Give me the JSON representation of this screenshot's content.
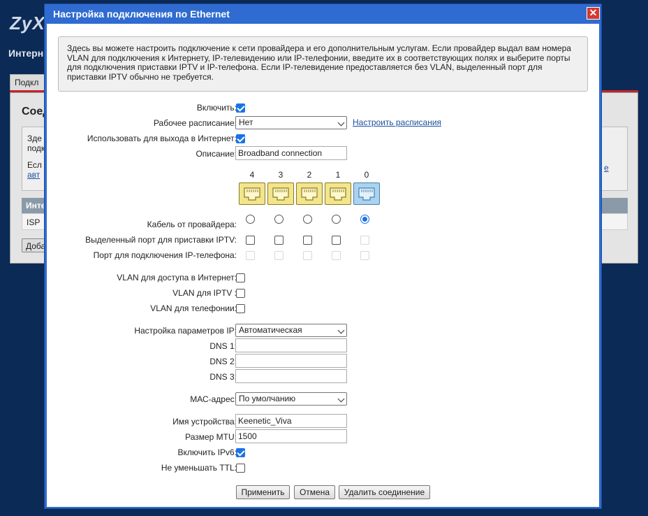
{
  "background": {
    "logo": "ZyX",
    "heading": "Интерн",
    "tab": "Подкл",
    "panel_title": "Соед",
    "text_line_1": "Зде",
    "text_line_2": "подк",
    "text_line_3": "Есл",
    "text_line_4": "авт",
    "link_fragment": "е",
    "table_header": "Инте",
    "table_row": "ISP",
    "add_button": "Доба"
  },
  "dialog": {
    "title": "Настройка подключения по Ethernet",
    "close": "✕",
    "intro": "Здесь вы можете настроить подключение к сети провайдера и его дополнительным услугам. Если провайдер выдал вам номера VLAN для подключения к Интернету, IP-телевидению или IP-телефонии, введите их в соответствующих полях и выберите порты для подключения приставки IPTV и IP-телефона. Если IP-телевидение предоставляется без VLAN, выделенный порт для приставки IPTV обычно не требуется.",
    "labels": {
      "enable": "Включить:",
      "schedule": "Рабочее расписание:",
      "use_internet": "Использовать для выхода в Интернет:",
      "description": "Описание:",
      "provider_cable": "Кабель от провайдера:",
      "iptv_port": "Выделенный порт для приставки IPTV:",
      "phone_port": "Порт для подключения IP-телефона:",
      "vlan_internet": "VLAN для доступа в Интернет:",
      "vlan_iptv": "VLAN для IPTV :",
      "vlan_phone": "VLAN для телефонии:",
      "ip_settings": "Настройка параметров IP:",
      "dns1": "DNS 1:",
      "dns2": "DNS 2:",
      "dns3": "DNS 3:",
      "mac": "МАС-адрес:",
      "device_name": "Имя устройства:",
      "mtu": "Размер MTU:",
      "ipv6": "Включить IPv6:",
      "ttl": "Не уменьшать TTL:"
    },
    "values": {
      "enable": true,
      "schedule": "Нет",
      "schedule_link": "Настроить расписания",
      "use_internet": true,
      "description": "Broadband connection",
      "ports": [
        "4",
        "3",
        "2",
        "1",
        "0"
      ],
      "provider_cable_selected": "0",
      "vlan_internet": false,
      "vlan_iptv": false,
      "vlan_phone": false,
      "ip_settings": "Автоматическая",
      "dns1": "",
      "dns2": "",
      "dns3": "",
      "mac": "По умолчанию",
      "device_name": "Keenetic_Viva",
      "mtu": "1500",
      "ipv6": true,
      "ttl": false
    },
    "buttons": {
      "apply": "Применить",
      "cancel": "Отмена",
      "delete": "Удалить соединение"
    }
  }
}
